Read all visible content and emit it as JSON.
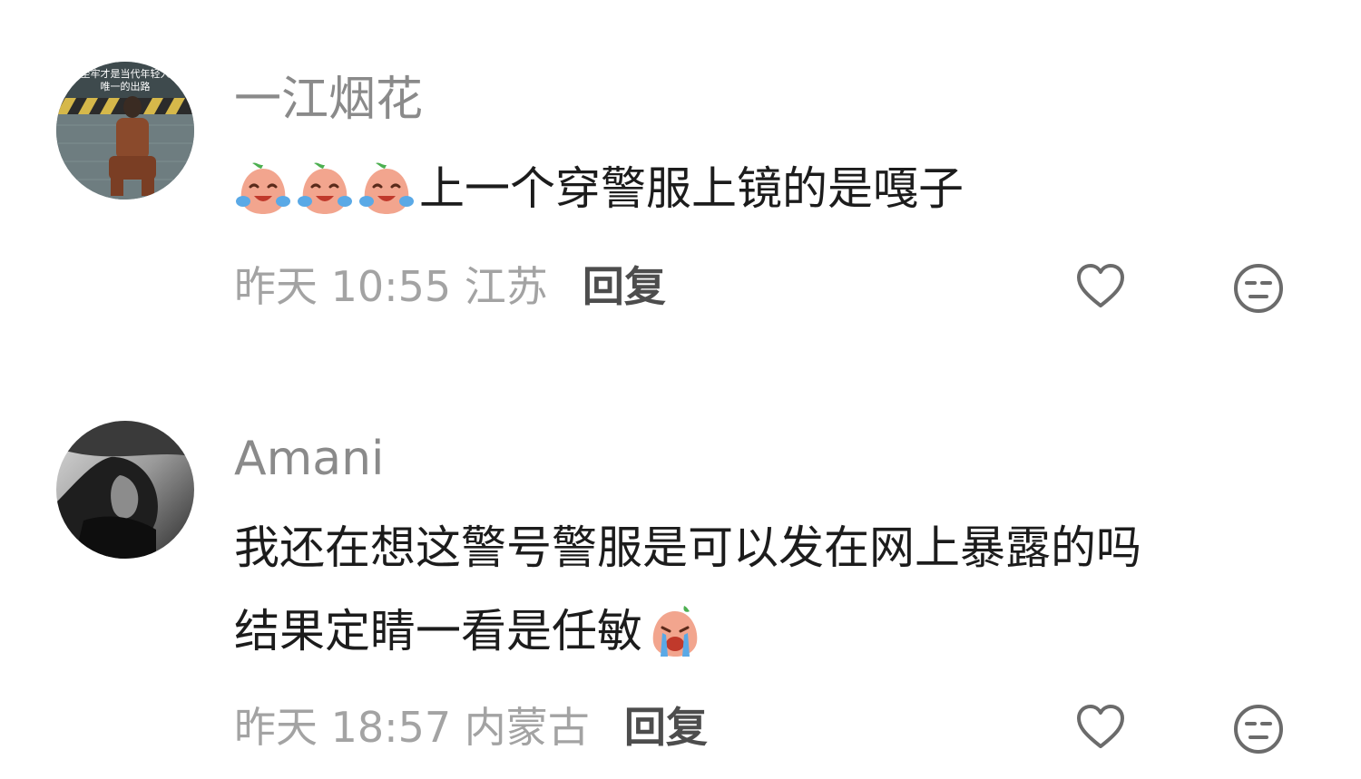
{
  "comments": [
    {
      "username": "一江烟花",
      "avatar_caption_line1": "坐牢才是当代年轻人",
      "avatar_caption_line2": "唯一的出路",
      "text": "上一个穿警服上镜的是嘎子",
      "emoji_prefix": [
        "laugh-cry-peach-emoji",
        "laugh-cry-peach-emoji",
        "laugh-cry-peach-emoji"
      ],
      "time_location": "昨天 10:55 江苏",
      "reply_label": "回复",
      "like_icon": "heart-outline-icon",
      "dislike_icon": "meh-face-icon"
    },
    {
      "username": "Amani",
      "text_line1": "我还在想这警号警服是可以发在网上暴露的吗",
      "text_line2": "结果定睛一看是任敏",
      "emoji_suffix": "sobbing-peach-emoji",
      "time_location": "昨天 18:57 内蒙古",
      "reply_label": "回复",
      "like_icon": "heart-outline-icon",
      "dislike_icon": "meh-face-icon"
    }
  ],
  "colors": {
    "username": "#8a8a8a",
    "meta_text": "#a3a3a3",
    "reply_text": "#4d4d4d",
    "body_text": "#1c1c1c",
    "icon_stroke": "#6b6b6b",
    "peach": "#f2a58e"
  }
}
